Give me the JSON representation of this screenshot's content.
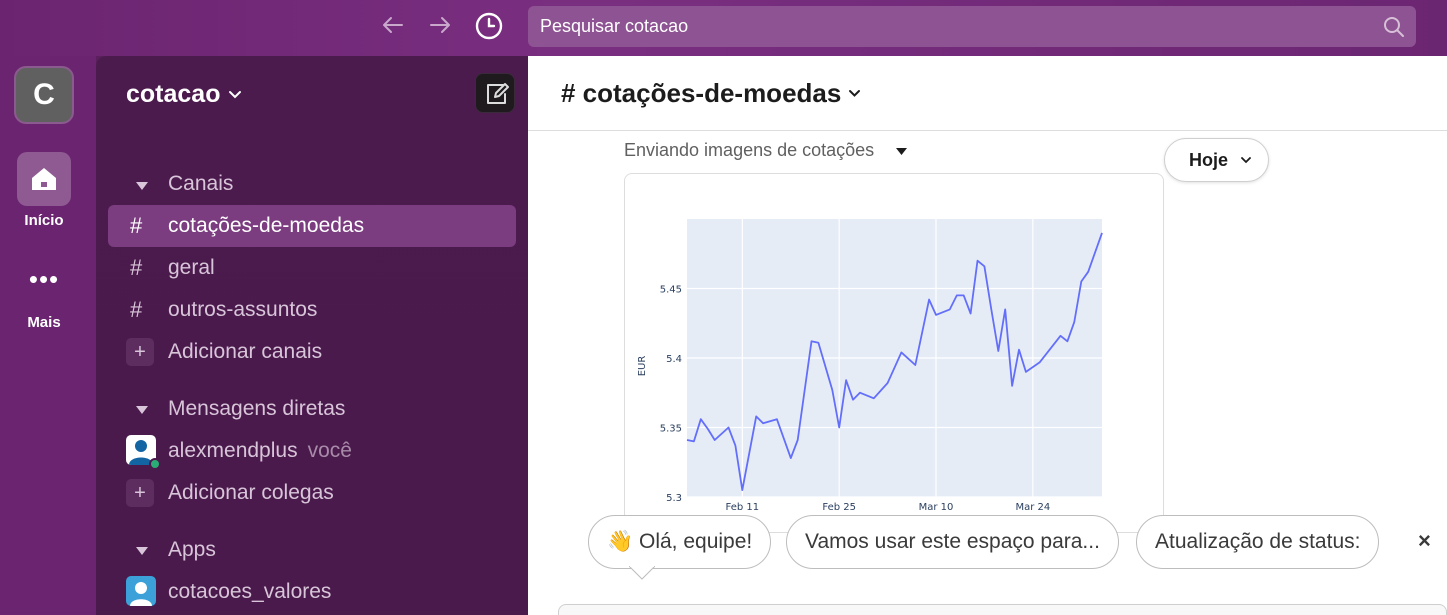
{
  "topbar": {
    "back_icon": "arrow-left-icon",
    "forward_icon": "arrow-right-icon",
    "history_icon": "clock-icon",
    "search_placeholder": "Pesquisar cotacao",
    "search_icon": "search-icon"
  },
  "rail": {
    "workspace_initial": "C",
    "home_label": "Início",
    "more_dots": "•••",
    "more_label": "Mais"
  },
  "sidebar": {
    "workspace_name": "cotacao",
    "channels_header": "Canais",
    "channels": [
      {
        "label": "cotações-de-moedas",
        "active": true
      },
      {
        "label": "geral",
        "active": false
      },
      {
        "label": "outros-assuntos",
        "active": false
      }
    ],
    "add_channels": "Adicionar canais",
    "dm_header": "Mensagens diretas",
    "dm_user": "alexmendplus",
    "dm_you": "você",
    "add_colleagues": "Adicionar colegas",
    "apps_header": "Apps",
    "app_name": "cotacoes_valores",
    "hash": "#",
    "plus": "+"
  },
  "main": {
    "channel_title": "# cotações-de-moedas",
    "caption": "Enviando imagens de cotações",
    "today_label": "Hoje",
    "chips": [
      "👋 Olá, equipe!",
      "Vamos usar este espaço para...",
      "Atualização de status:"
    ],
    "close_label": "×"
  },
  "colors": {
    "rail_bg": "#6b2570",
    "sidebar_bg": "#4a1a4c",
    "active_item": "#7b3c80",
    "chart_line": "#636efa",
    "chart_bg": "#e5ecf6"
  },
  "chart_data": {
    "type": "line",
    "title": "",
    "xlabel": "",
    "ylabel": "EUR",
    "ylim": [
      5.3,
      5.5
    ],
    "yticks": [
      5.3,
      5.35,
      5.4,
      5.45
    ],
    "ytick_labels": [
      "5.3",
      "5.35",
      "5.4",
      "5.45"
    ],
    "xticks": [
      "Feb 11",
      "Feb 25",
      "Mar 10",
      "Mar 24"
    ],
    "xtick_positions_day": [
      9,
      23,
      37,
      51
    ],
    "x_day_range": [
      1,
      61
    ],
    "grid": true,
    "series": [
      {
        "values": [
          [
            1,
            5.341
          ],
          [
            2,
            5.34
          ],
          [
            3,
            5.356
          ],
          [
            4,
            5.349
          ],
          [
            5,
            5.341
          ],
          [
            7,
            5.35
          ],
          [
            8,
            5.337
          ],
          [
            9,
            5.305
          ],
          [
            11,
            5.358
          ],
          [
            12,
            5.353
          ],
          [
            14,
            5.356
          ],
          [
            16,
            5.328
          ],
          [
            17,
            5.341
          ],
          [
            19,
            5.412
          ],
          [
            20,
            5.411
          ],
          [
            22,
            5.377
          ],
          [
            23,
            5.35
          ],
          [
            24,
            5.384
          ],
          [
            25,
            5.37
          ],
          [
            26,
            5.375
          ],
          [
            28,
            5.371
          ],
          [
            30,
            5.382
          ],
          [
            32,
            5.404
          ],
          [
            34,
            5.395
          ],
          [
            36,
            5.442
          ],
          [
            37,
            5.431
          ],
          [
            39,
            5.435
          ],
          [
            40,
            5.445
          ],
          [
            41,
            5.445
          ],
          [
            42,
            5.432
          ],
          [
            43,
            5.47
          ],
          [
            44,
            5.466
          ],
          [
            45,
            5.435
          ],
          [
            46,
            5.405
          ],
          [
            47,
            5.435
          ],
          [
            48,
            5.38
          ],
          [
            49,
            5.406
          ],
          [
            50,
            5.39
          ],
          [
            52,
            5.397
          ],
          [
            55,
            5.416
          ],
          [
            56,
            5.412
          ],
          [
            57,
            5.426
          ],
          [
            58,
            5.455
          ],
          [
            59,
            5.462
          ],
          [
            61,
            5.49
          ]
        ]
      }
    ]
  }
}
